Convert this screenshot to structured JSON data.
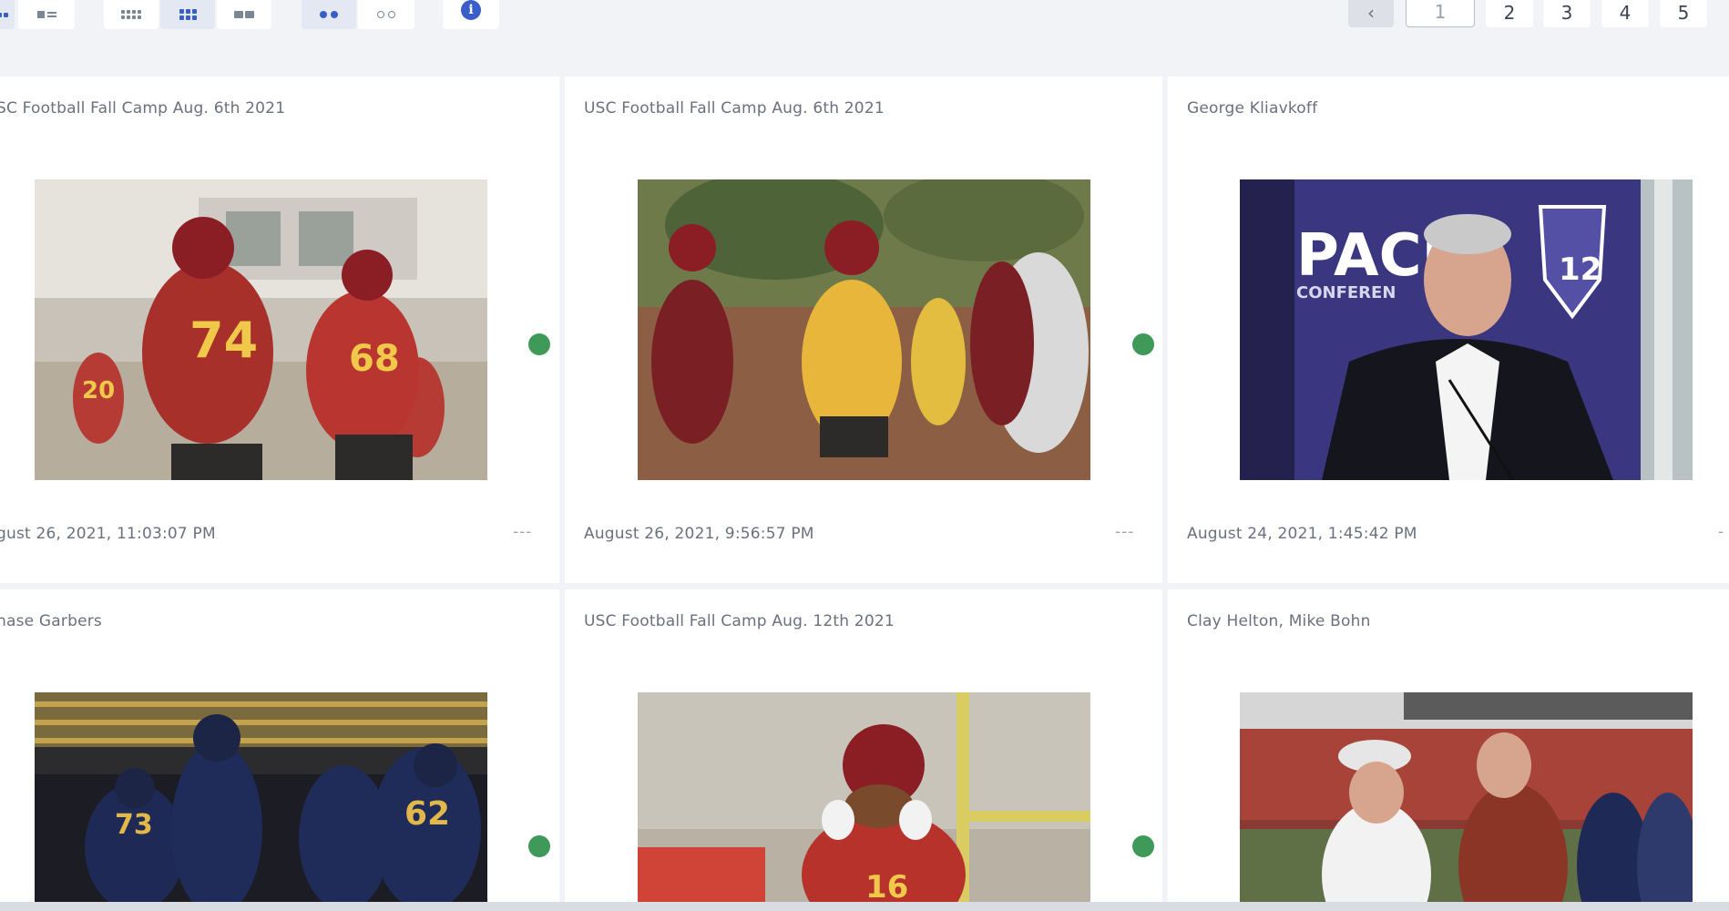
{
  "toolbar": {
    "view_buttons": [
      {
        "name": "grid-view-button",
        "icon": "grid-icon"
      },
      {
        "name": "list-view-button",
        "icon": "list-icon"
      },
      {
        "name": "small-grid-button",
        "icon": "small-grid-icon"
      },
      {
        "name": "medium-grid-button",
        "icon": "medium-grid-icon",
        "active": true
      },
      {
        "name": "large-grid-button",
        "icon": "large-grid-icon"
      },
      {
        "name": "show-status-button",
        "icon": "filled-dots-icon",
        "active": true
      },
      {
        "name": "hide-status-button",
        "icon": "hollow-dots-icon"
      },
      {
        "name": "info-button",
        "icon": "info-icon"
      }
    ],
    "info_glyph": "i"
  },
  "pagination": {
    "prev_glyph": "‹",
    "current_page": "1",
    "pages": [
      "2",
      "3",
      "4",
      "5"
    ]
  },
  "colors": {
    "accent": "#3a5ec7",
    "status_green": "#3f9a5a",
    "background": "#f1f3f6"
  },
  "cards": [
    {
      "title": "SC Football Fall Camp Aug. 6th 2021",
      "date": "gust 26, 2021, 11:03:07 PM",
      "menu": "---",
      "status": "green"
    },
    {
      "title": "USC Football Fall Camp Aug. 6th 2021",
      "date": "August 26, 2021, 9:56:57 PM",
      "menu": "---",
      "status": "green"
    },
    {
      "title": "George Kliavkoff",
      "date": "August 24, 2021, 1:45:42 PM",
      "menu": "-",
      "status": "none"
    },
    {
      "title": "hase Garbers",
      "date": "",
      "menu": "",
      "status": "green"
    },
    {
      "title": "USC Football Fall Camp Aug. 12th 2021",
      "date": "",
      "menu": "",
      "status": "green"
    },
    {
      "title": "Clay Helton, Mike Bohn",
      "date": "",
      "menu": "",
      "status": "none"
    }
  ],
  "photo_overlay_text": {
    "pac_left": "PACI",
    "pac_sub": "CONFEREN",
    "pac_shield": "12",
    "jersey_74": "74",
    "jersey_68": "68",
    "jersey_20": "20",
    "jersey_73": "73",
    "jersey_62": "62",
    "jersey_16": "16"
  }
}
